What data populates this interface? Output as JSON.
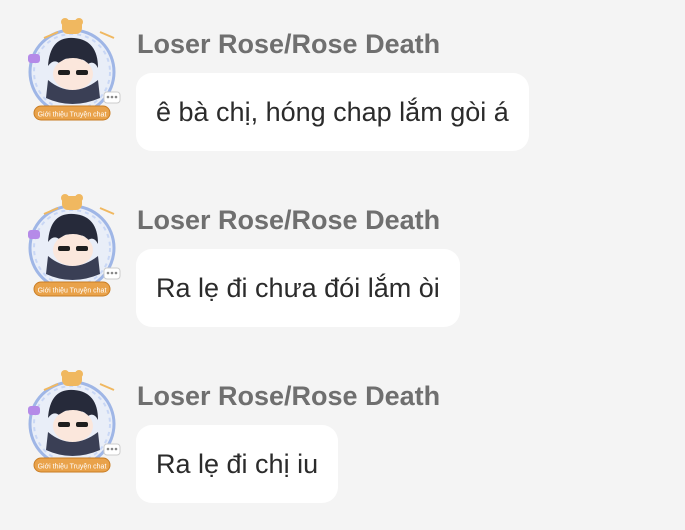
{
  "messages": [
    {
      "sender": "Loser Rose/Rose Death",
      "text": "ê bà chị, hóng chap lắm gòi á",
      "avatar_badge": "Giới thiệu Truyện chat"
    },
    {
      "sender": "Loser Rose/Rose Death",
      "text": "Ra lẹ đi chưa đói lắm òi",
      "avatar_badge": "Giới thiệu Truyện chat"
    },
    {
      "sender": "Loser Rose/Rose Death",
      "text": "Ra lẹ đi chị iu",
      "avatar_badge": "Giới thiệu Truyện chat"
    }
  ],
  "colors": {
    "background": "#f4f4f4",
    "bubble": "#ffffff",
    "sender_text": "#6f6f6f",
    "message_text": "#2b2b2b",
    "badge": "#e9a24a"
  },
  "icons": {
    "avatar": "chibi-avatar-icon",
    "frame_chat": "chat-bubble-icon"
  }
}
